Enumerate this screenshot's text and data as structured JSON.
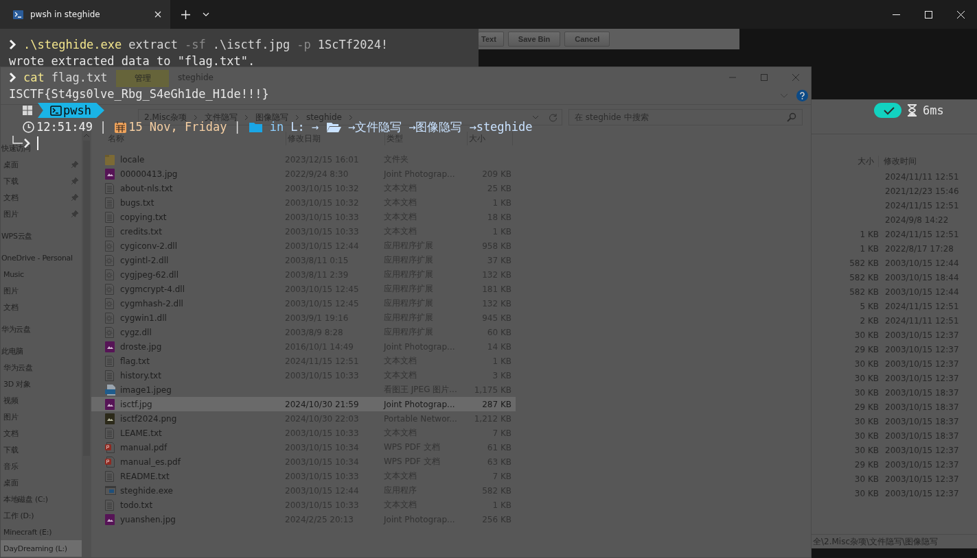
{
  "terminal": {
    "tab": {
      "title": "pwsh in steghide"
    },
    "lines": [
      {
        "kind": "command",
        "parts": [
          {
            "kind": "exe",
            "text": ".\\steghide.exe"
          },
          {
            "kind": "arg",
            "text": "extract"
          },
          {
            "kind": "flag",
            "text": "-sf"
          },
          {
            "kind": "arg",
            "text": ".\\isctf.jpg"
          },
          {
            "kind": "flag",
            "text": "-p"
          },
          {
            "kind": "arg",
            "text": "1ScTf2024!"
          }
        ]
      },
      {
        "kind": "output",
        "text": "wrote extracted data to \"flag.txt\"."
      },
      {
        "kind": "command",
        "parts": [
          {
            "kind": "exe",
            "text": "cat"
          },
          {
            "kind": "arg",
            "text": "flag.txt"
          }
        ]
      },
      {
        "kind": "output",
        "text": "ISCTF{St4gs0lve_Rbg_S4eGh1de_H1de!!!}"
      }
    ],
    "prompt": {
      "shell": "pwsh",
      "info": [
        {
          "kind": "clock"
        },
        {
          "kind": "time",
          "text": "12:51:49"
        },
        {
          "kind": "separator",
          "text": "|"
        },
        {
          "kind": "calendar"
        },
        {
          "kind": "date",
          "text": "15 Nov, Friday"
        },
        {
          "kind": "separator",
          "text": "|"
        },
        {
          "kind": "folder"
        },
        {
          "kind": "keyword",
          "text": "in"
        },
        {
          "kind": "path",
          "text": "L:"
        },
        {
          "kind": "path",
          "text": "→"
        },
        {
          "kind": "folder-open"
        },
        {
          "kind": "path",
          "text": "→文件隐写"
        },
        {
          "kind": "path",
          "text": "→图像隐写"
        },
        {
          "kind": "path",
          "text": "→steghide"
        }
      ],
      "status": {
        "ok": true,
        "duration": "6ms"
      }
    }
  },
  "dialog": {
    "buttons": [
      "Text",
      "Save Bin",
      "Cancel"
    ]
  },
  "explorer": {
    "context_tab": "管理",
    "title": "steghide",
    "breadcrumb": [
      "2.Misc杂项",
      "文件隐写",
      "图像隐写",
      "steghide"
    ],
    "search": {
      "placeholder": "在 steghide 中搜索"
    },
    "sidebar": [
      {
        "label": "快速访问",
        "selected": false,
        "children": [
          {
            "label": "桌面",
            "pinned": true,
            "selected": false
          },
          {
            "label": "下载",
            "pinned": true,
            "selected": false
          },
          {
            "label": "文档",
            "pinned": true,
            "selected": false
          },
          {
            "label": "图片",
            "pinned": true,
            "selected": false
          }
        ]
      },
      {
        "label": "WPS云盘",
        "selected": false
      },
      {
        "label": "OneDrive - Personal",
        "selected": false,
        "children": [
          {
            "label": "Music",
            "selected": false
          },
          {
            "label": "图片",
            "selected": false
          },
          {
            "label": "文档",
            "selected": false
          }
        ]
      },
      {
        "label": "华为云盘",
        "selected": false
      },
      {
        "label": "此电脑",
        "selected": false,
        "children": [
          {
            "label": "华为云盘",
            "selected": false
          },
          {
            "label": "3D 对象",
            "selected": false
          },
          {
            "label": "视频",
            "selected": false
          },
          {
            "label": "图片",
            "selected": false
          },
          {
            "label": "文档",
            "selected": false
          },
          {
            "label": "下载",
            "selected": false
          },
          {
            "label": "音乐",
            "selected": false
          },
          {
            "label": "桌面",
            "selected": false
          },
          {
            "label": "本地磁盘 (C:)",
            "selected": false
          },
          {
            "label": "工作 (D:)",
            "selected": false
          },
          {
            "label": "Minecraft (E:)",
            "selected": false
          },
          {
            "label": "DayDreaming (L:)",
            "selected": true
          }
        ]
      }
    ],
    "columns": [
      "名称",
      "修改日期",
      "类型",
      "大小"
    ],
    "files": [
      {
        "kind": "folder",
        "name": "locale",
        "date": "2023/12/15 16:01",
        "type": "文件夹",
        "selected": false
      },
      {
        "kind": "jpg",
        "name": "00000413.jpg",
        "date": "2022/9/24 8:30",
        "type": "Joint Photograp...",
        "size": "209 KB",
        "selected": false
      },
      {
        "kind": "txt",
        "name": "about-nls.txt",
        "date": "2003/10/15 10:32",
        "type": "文本文档",
        "size": "25 KB",
        "selected": false
      },
      {
        "kind": "txt",
        "name": "bugs.txt",
        "date": "2003/10/15 10:32",
        "type": "文本文档",
        "size": "1 KB",
        "selected": false
      },
      {
        "kind": "txt",
        "name": "copying.txt",
        "date": "2003/10/15 10:33",
        "type": "文本文档",
        "size": "18 KB",
        "selected": false
      },
      {
        "kind": "txt",
        "name": "credits.txt",
        "date": "2003/10/15 10:33",
        "type": "文本文档",
        "size": "1 KB",
        "selected": false
      },
      {
        "kind": "dll",
        "name": "cygiconv-2.dll",
        "date": "2003/10/15 12:44",
        "type": "应用程序扩展",
        "size": "958 KB",
        "selected": false
      },
      {
        "kind": "dll",
        "name": "cygintl-2.dll",
        "date": "2003/8/11 0:15",
        "type": "应用程序扩展",
        "size": "37 KB",
        "selected": false
      },
      {
        "kind": "dll",
        "name": "cygjpeg-62.dll",
        "date": "2003/8/11 2:39",
        "type": "应用程序扩展",
        "size": "132 KB",
        "selected": false
      },
      {
        "kind": "dll",
        "name": "cygmcrypt-4.dll",
        "date": "2003/10/15 12:45",
        "type": "应用程序扩展",
        "size": "181 KB",
        "selected": false
      },
      {
        "kind": "dll",
        "name": "cygmhash-2.dll",
        "date": "2003/10/15 12:45",
        "type": "应用程序扩展",
        "size": "132 KB",
        "selected": false
      },
      {
        "kind": "dll",
        "name": "cygwin1.dll",
        "date": "2003/9/1 19:16",
        "type": "应用程序扩展",
        "size": "945 KB",
        "selected": false
      },
      {
        "kind": "dll",
        "name": "cygz.dll",
        "date": "2003/8/9 8:28",
        "type": "应用程序扩展",
        "size": "60 KB",
        "selected": false
      },
      {
        "kind": "jpg",
        "name": "droste.jpg",
        "date": "2016/10/1 14:49",
        "type": "Joint Photograp...",
        "size": "14 KB",
        "selected": false
      },
      {
        "kind": "txt",
        "name": "flag.txt",
        "date": "2024/11/15 12:51",
        "type": "文本文档",
        "size": "1 KB",
        "selected": false
      },
      {
        "kind": "txt",
        "name": "history.txt",
        "date": "2003/10/15 10:33",
        "type": "文本文档",
        "size": "3 KB",
        "selected": false
      },
      {
        "kind": "jpeg",
        "name": "image1.jpeg",
        "type": "看图王 JPEG 图片...",
        "size": "1,175 KB",
        "selected": false
      },
      {
        "kind": "jpg",
        "name": "isctf.jpg",
        "date": "2024/10/30 21:59",
        "type": "Joint Photograp...",
        "size": "287 KB",
        "selected": true
      },
      {
        "kind": "png",
        "name": "isctf2024.png",
        "date": "2024/10/30 22:03",
        "type": "Portable Networ...",
        "size": "1,212 KB",
        "selected": false
      },
      {
        "kind": "txt",
        "name": "LEAME.txt",
        "date": "2003/10/15 10:33",
        "type": "文本文档",
        "size": "7 KB",
        "selected": false
      },
      {
        "kind": "pdf",
        "name": "manual.pdf",
        "date": "2003/10/15 10:34",
        "type": "WPS PDF 文档",
        "size": "61 KB",
        "selected": false
      },
      {
        "kind": "pdf",
        "name": "manual_es.pdf",
        "date": "2003/10/15 10:34",
        "type": "WPS PDF 文档",
        "size": "63 KB",
        "selected": false
      },
      {
        "kind": "txt",
        "name": "README.txt",
        "date": "2003/10/15 10:33",
        "type": "文本文档",
        "size": "7 KB",
        "selected": false
      },
      {
        "kind": "exe",
        "name": "steghide.exe",
        "date": "2003/10/15 12:44",
        "type": "应用程序",
        "size": "582 KB",
        "selected": false
      },
      {
        "kind": "txt",
        "name": "todo.txt",
        "date": "2003/10/15 10:33",
        "type": "文本文档",
        "size": "1 KB",
        "selected": false
      },
      {
        "kind": "jpg",
        "name": "yuanshen.jpg",
        "date": "2024/2/25 20:13",
        "type": "Joint Photograp...",
        "size": "256 KB",
        "selected": false
      }
    ]
  },
  "back_explorer": {
    "columns": [
      "大小",
      "修改时间"
    ],
    "rows": [
      {
        "date": "2024/11/11 12:51"
      },
      {
        "date": "2021/12/23 15:46"
      },
      {
        "date": "2024/11/15 12:51"
      },
      {
        "date": "2024/9/8 14:22"
      },
      {
        "size": "1 KB",
        "date": "2024/11/15 12:51"
      },
      {
        "size": "1 KB",
        "date": "2022/8/17 17:28"
      },
      {
        "size": "582 KB",
        "date": "2003/10/15 12:44"
      },
      {
        "size": "582 KB",
        "date": "2003/10/15 18:44"
      },
      {
        "size": "582 KB",
        "date": "2003/10/15 12:44"
      },
      {
        "size": "5 KB",
        "date": "2024/11/15 12:51"
      },
      {
        "size": "2 KB",
        "date": "2024/11/11 12:51"
      },
      {
        "size": "30 KB",
        "date": "2003/10/15 12:37"
      },
      {
        "size": "29 KB",
        "date": "2003/10/15 12:37"
      },
      {
        "size": "30 KB",
        "date": "2003/10/15 12:37"
      },
      {
        "size": "30 KB",
        "date": "2003/10/15 12:37"
      },
      {
        "size": "30 KB",
        "date": "2003/10/15 18:37"
      },
      {
        "size": "29 KB",
        "date": "2003/10/15 18:37"
      },
      {
        "size": "30 KB",
        "date": "2003/10/15 18:37"
      },
      {
        "size": "30 KB",
        "date": "2003/10/15 18:37"
      },
      {
        "size": "30 KB",
        "date": "2003/10/15 12:37"
      },
      {
        "size": "29 KB",
        "date": "2003/10/15 12:37"
      },
      {
        "size": "30 KB",
        "date": "2003/10/15 12:37"
      },
      {
        "size": "30 KB",
        "date": "2003/10/15 12:37"
      }
    ],
    "status_path": "全\\2.Misc杂项\\文件隐写\\图像隐写"
  }
}
